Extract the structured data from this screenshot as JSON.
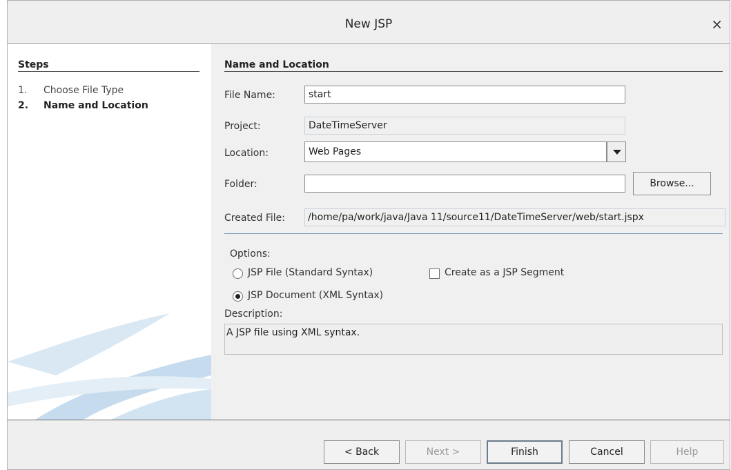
{
  "dialog": {
    "title": "New JSP",
    "close_glyph": "×"
  },
  "steps": {
    "heading": "Steps",
    "items": [
      {
        "num": "1.",
        "label": "Choose File Type"
      },
      {
        "num": "2.",
        "label": "Name and Location"
      }
    ]
  },
  "form": {
    "heading": "Name and Location",
    "file_name_label": "File Name:",
    "file_name_value": "start",
    "project_label": "Project:",
    "project_value": "DateTimeServer",
    "location_label": "Location:",
    "location_value": "Web Pages",
    "folder_label": "Folder:",
    "folder_value": "",
    "browse_label": "Browse...",
    "created_file_label": "Created File:",
    "created_file_value": "/home/pa/work/java/Java 11/source11/DateTimeServer/web/start.jspx",
    "options_label": "Options:",
    "option_jsp_file": "JSP File (Standard Syntax)",
    "option_jsp_document": "JSP Document (XML Syntax)",
    "option_selected": "JSP Document (XML Syntax)",
    "segment_label": "Create as a JSP Segment",
    "segment_checked": false,
    "description_label": "Description:",
    "description_value": "A JSP file using XML syntax."
  },
  "buttons": {
    "back": "< Back",
    "next": "Next >",
    "finish": "Finish",
    "cancel": "Cancel",
    "help": "Help"
  },
  "colors": {
    "accent_line": "#7d9ab8",
    "panel_bg": "#f0f0f0"
  }
}
